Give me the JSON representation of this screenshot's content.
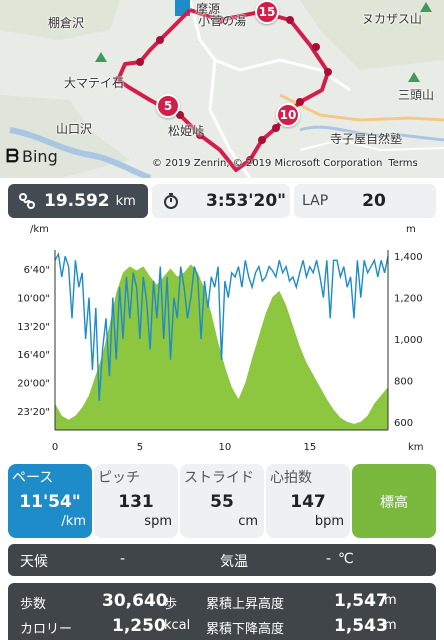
{
  "map": {
    "labels": {
      "tanakurasawa": "棚倉沢",
      "omateishi": "大マテイ石",
      "yamaguchisawa": "山口沢",
      "koganoyu": "小菅の湯",
      "matsuhime": "松姫峠",
      "nukazasuyama": "ヌカザス山",
      "mitsuatamayama": "三頭山",
      "terakoyashizenjuku": "寺子屋自然塾",
      "atagozawa": "摩源"
    },
    "markers": [
      "15",
      "5",
      "10"
    ],
    "bing": "Bing",
    "copyright": "© 2019 Zenrin, © 2019 Microsoft Corporation",
    "terms": "Terms",
    "route_color": "#d21f4a"
  },
  "stats": {
    "distance": {
      "icon": "route-icon",
      "value": "19.592",
      "unit": "km"
    },
    "time": {
      "icon": "stopwatch-icon",
      "value": "3:53'20\""
    },
    "lap": {
      "label": "LAP",
      "value": "20"
    }
  },
  "chart_data": {
    "type": "line",
    "y_left_unit": "/km",
    "y_right_unit": "m",
    "x_unit": "km",
    "x_ticks": [
      "0",
      "5",
      "10",
      "15"
    ],
    "xlim": [
      0,
      19.6
    ],
    "y_left_ticks": [
      "6'40\"",
      "10'00\"",
      "13'20\"",
      "16'40\"",
      "20'00\"",
      "23'20\""
    ],
    "y_right_ticks": [
      "1,400",
      "1,200",
      "1,000",
      "800",
      "600"
    ],
    "series": [
      {
        "kind": "area",
        "color": "#8dc63f",
        "ylim": [
          550,
          1430
        ],
        "x": [
          0,
          0.4,
          0.8,
          1.2,
          1.6,
          2.0,
          2.4,
          2.8,
          3.2,
          3.6,
          4.0,
          4.4,
          4.8,
          5.2,
          5.6,
          6.0,
          6.4,
          6.8,
          7.2,
          7.6,
          8.0,
          8.4,
          8.8,
          9.2,
          9.6,
          10.0,
          10.4,
          10.8,
          11.2,
          11.6,
          12.0,
          12.4,
          12.8,
          13.2,
          13.6,
          14.0,
          14.4,
          14.8,
          15.2,
          15.6,
          16.0,
          16.4,
          16.8,
          17.2,
          17.6,
          18.0,
          18.4,
          18.8,
          19.2,
          19.6
        ],
        "values": [
          680,
          620,
          600,
          620,
          660,
          720,
          820,
          920,
          1060,
          1220,
          1320,
          1350,
          1330,
          1350,
          1300,
          1260,
          1300,
          1340,
          1300,
          1320,
          1360,
          1320,
          1240,
          1120,
          980,
          860,
          760,
          700,
          780,
          900,
          1010,
          1120,
          1200,
          1230,
          1160,
          1060,
          960,
          880,
          820,
          760,
          700,
          650,
          610,
          590,
          580,
          590,
          620,
          680,
          720,
          760
        ]
      },
      {
        "kind": "line",
        "color": "#1d8cc9",
        "ylim": [
          560,
          1430
        ],
        "x": [
          0,
          0.2,
          0.4,
          0.6,
          0.8,
          1.0,
          1.2,
          1.4,
          1.6,
          1.8,
          2.0,
          2.2,
          2.4,
          2.6,
          2.8,
          3.0,
          3.2,
          3.4,
          3.6,
          3.8,
          4.0,
          4.2,
          4.4,
          4.6,
          4.8,
          5.0,
          5.2,
          5.4,
          5.6,
          5.8,
          6.0,
          6.2,
          6.4,
          6.6,
          6.8,
          7.0,
          7.2,
          7.4,
          7.6,
          7.8,
          8.0,
          8.2,
          8.4,
          8.6,
          8.8,
          9.0,
          9.2,
          9.4,
          9.6,
          9.8,
          10.0,
          10.2,
          10.4,
          10.6,
          10.8,
          11.0,
          11.2,
          11.4,
          11.6,
          11.8,
          12.0,
          12.2,
          12.4,
          12.6,
          12.8,
          13.0,
          13.2,
          13.4,
          13.6,
          13.8,
          14.0,
          14.2,
          14.4,
          14.6,
          14.8,
          15.0,
          15.2,
          15.4,
          15.6,
          15.8,
          16.0,
          16.2,
          16.4,
          16.6,
          16.8,
          17.0,
          17.2,
          17.4,
          17.6,
          17.8,
          18.0,
          18.2,
          18.4,
          18.6,
          18.8,
          19.0,
          19.2,
          19.4,
          19.6
        ],
        "values": [
          1380,
          1410,
          1300,
          1400,
          1350,
          1100,
          1380,
          1250,
          1320,
          1000,
          1200,
          850,
          1150,
          700,
          950,
          1100,
          820,
          1200,
          900,
          1250,
          1000,
          1300,
          1100,
          1320,
          1250,
          1000,
          1300,
          1180,
          950,
          1280,
          1100,
          1350,
          1000,
          1300,
          900,
          1200,
          1100,
          1350,
          1250,
          1100,
          1200,
          1350,
          1300,
          1000,
          1280,
          1150,
          1300,
          1250,
          1350,
          900,
          1280,
          1200,
          1320,
          1300,
          1350,
          1250,
          1380,
          1300,
          1250,
          1320,
          1350,
          1280,
          1300,
          1350,
          1330,
          1300,
          1380,
          1320,
          1350,
          1280,
          1300,
          1250,
          1320,
          1380,
          1300,
          1350,
          1320,
          1380,
          1300,
          1200,
          1380,
          1100,
          1380,
          1380,
          1300,
          1350,
          1250,
          1300,
          1100,
          1380,
          1200,
          1380,
          1320,
          1350,
          1380,
          1300,
          1380,
          1320,
          1400
        ]
      }
    ]
  },
  "metrics": [
    {
      "id": "pace",
      "label": "ペース",
      "value": "11'54\"",
      "unit": "/km"
    },
    {
      "id": "pitch",
      "label": "ピッチ",
      "value": "131",
      "unit": "spm"
    },
    {
      "id": "stride",
      "label": "ストライド",
      "value": "55",
      "unit": "cm"
    },
    {
      "id": "hr",
      "label": "心拍数",
      "value": "147",
      "unit": "bpm"
    },
    {
      "id": "alt",
      "label": "標高"
    }
  ],
  "weather": {
    "label": "天候",
    "value": "-",
    "temp_label": "気温",
    "temp_value": "-",
    "temp_unit": "℃"
  },
  "summary": {
    "steps_label": "歩数",
    "steps_value": "30,640",
    "steps_unit": "歩",
    "ascent_label": "累積上昇高度",
    "ascent_value": "1,547",
    "ascent_unit": "m",
    "cal_label": "カロリー",
    "cal_value": "1,250",
    "cal_unit": "kcal",
    "descent_label": "累積下降高度",
    "descent_value": "1,543",
    "descent_unit": "m"
  },
  "colors": {
    "accent": "#1d8cc9",
    "elevation": "#8dc63f",
    "dark_panel": "#3f4549"
  }
}
